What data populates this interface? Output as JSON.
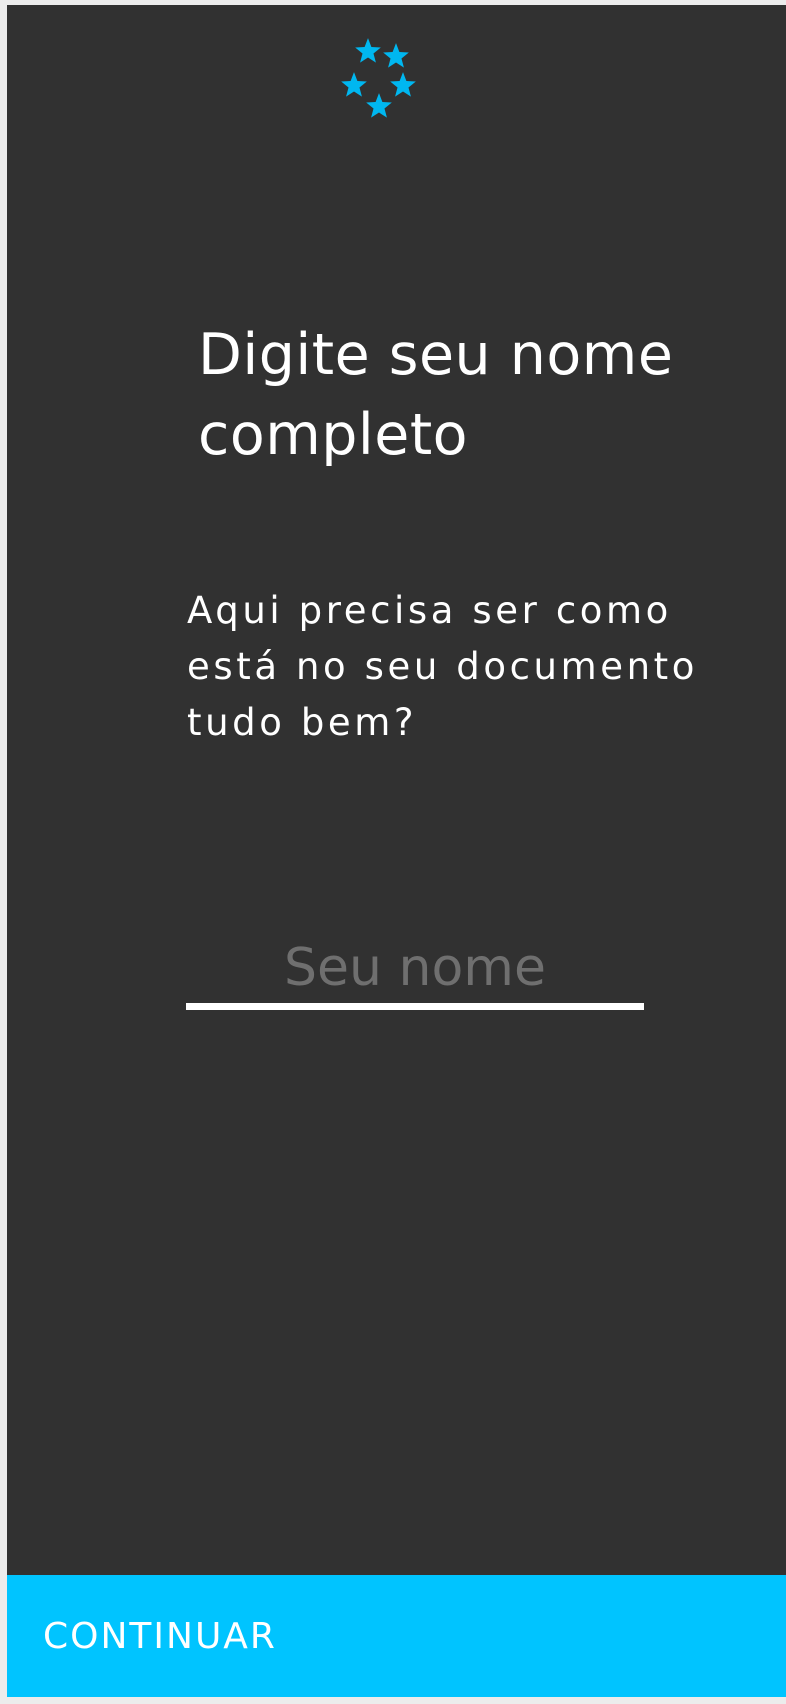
{
  "logo": {
    "icon": "stars-circle-icon",
    "color": "#00B7F0"
  },
  "content": {
    "title_line1": "Digite seu nome",
    "title_line2": "completo",
    "subtitle_line1": "Aqui precisa ser como",
    "subtitle_line2": "está no seu documento",
    "subtitle_line3": "tudo bem?"
  },
  "name_field": {
    "placeholder": "Seu nome",
    "value": ""
  },
  "continue_button": {
    "label": "CONTINUAR",
    "color": "#00C4FF"
  },
  "colors": {
    "background": "#313131",
    "text": "#FFFFFF",
    "placeholder": "#6F6F6F"
  }
}
